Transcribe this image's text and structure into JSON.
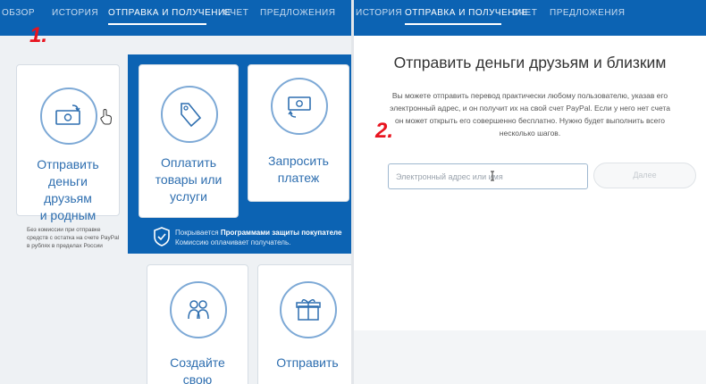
{
  "left": {
    "nav": [
      "ОБЗОР",
      "ИСТОРИЯ",
      "ОТПРАВКА И ПОЛУЧЕНИЕ",
      "СЧЕТ",
      "ПРЕДЛОЖЕНИЯ"
    ],
    "step_label": "1.",
    "card_send": {
      "line1": "Отправить",
      "line2": "деньги друзьям",
      "line3": "и родным"
    },
    "card_pay": {
      "line1": "Оплатить",
      "line2": "товары или",
      "line3": "услуги"
    },
    "card_request": {
      "line1": "Запросить",
      "line2": "платеж"
    },
    "note": {
      "line1": "Без комиссии при отправке",
      "line2": "средств с остатка на счете PayPal",
      "line3": "в рублях в пределах России"
    },
    "protection": {
      "prefix": "Покрывается ",
      "bold": "Программами защиты покупателе",
      "line2": "Комиссию оплачивает получатель."
    },
    "card_create": {
      "line1": "Создайте свою"
    },
    "card_send_gift": {
      "line1": "Отправить"
    }
  },
  "right": {
    "nav": [
      "ИСТОРИЯ",
      "ОТПРАВКА И ПОЛУЧЕНИЕ",
      "СЧЕТ",
      "ПРЕДЛОЖЕНИЯ"
    ],
    "step_label": "2.",
    "title": "Отправить деньги друзьям и близким",
    "desc": {
      "line1": "Вы можете отправить перевод практически любому пользователю, указав его",
      "line2": "электронный адрес, и он получит их на свой счет PayPal. Если у него нет счета",
      "line3": "он может открыть его совершенно бесплатно. Нужно будет выполнить всего",
      "line4": "несколько шагов."
    },
    "email_placeholder": "Электронный адрес или имя",
    "next_button": "Далее"
  },
  "colors": {
    "brand_blue": "#0c63b3",
    "step_red": "#e8141f",
    "link_blue": "#2f6fb0"
  }
}
